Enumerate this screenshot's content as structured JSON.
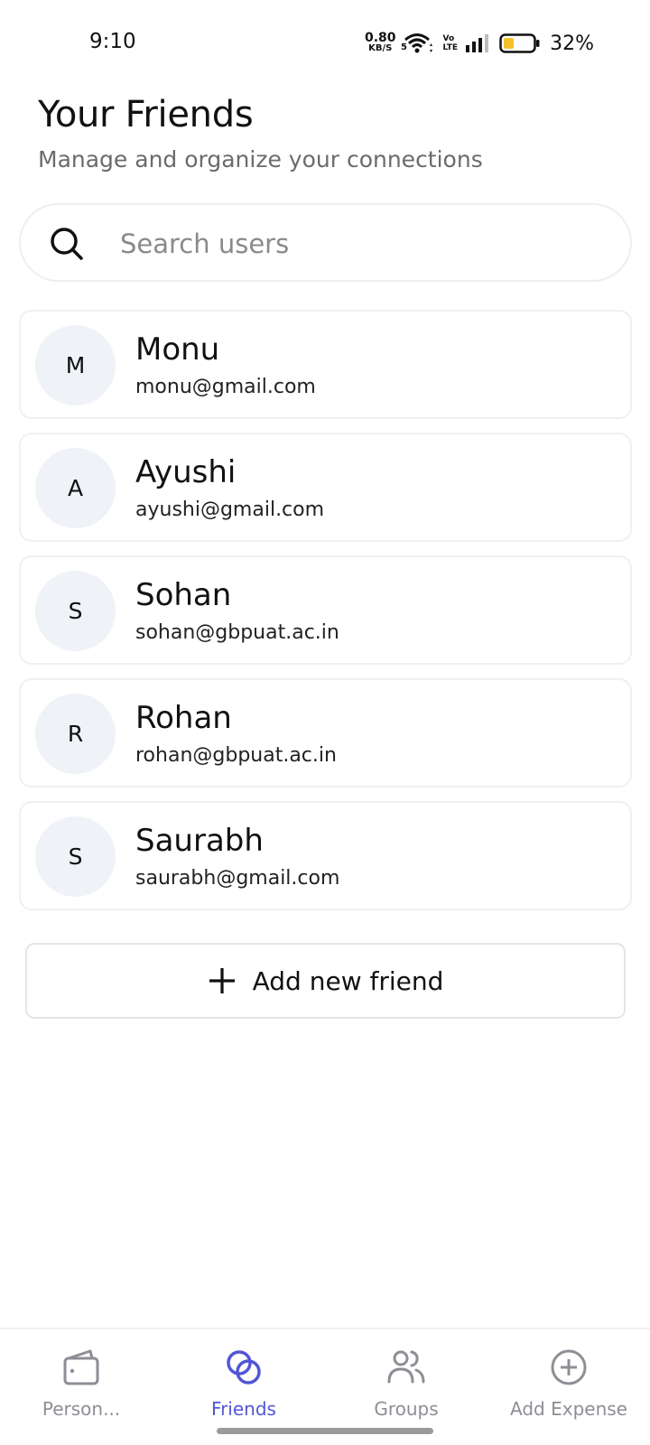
{
  "status_bar": {
    "time": "9:10",
    "net_speed_value": "0.80",
    "net_speed_unit": "KB/S",
    "wifi_badge": "5",
    "volte_top": "Vo",
    "volte_bottom": "LTE",
    "battery_percent": "32%"
  },
  "header": {
    "title": "Your Friends",
    "subtitle": "Manage and organize your connections"
  },
  "search": {
    "placeholder": "Search users",
    "value": ""
  },
  "friends": [
    {
      "initial": "M",
      "name": "Monu",
      "email": "monu@gmail.com"
    },
    {
      "initial": "A",
      "name": "Ayushi",
      "email": "ayushi@gmail.com"
    },
    {
      "initial": "S",
      "name": "Sohan",
      "email": "sohan@gbpuat.ac.in"
    },
    {
      "initial": "R",
      "name": "Rohan",
      "email": "rohan@gbpuat.ac.in"
    },
    {
      "initial": "S",
      "name": "Saurabh",
      "email": "saurabh@gmail.com"
    }
  ],
  "add_friend": {
    "label": "Add new friend",
    "icon": "plus-icon"
  },
  "bottom_nav": {
    "items": [
      {
        "label": "Person...",
        "icon": "wallet-icon",
        "active": false
      },
      {
        "label": "Friends",
        "icon": "friends-rings-icon",
        "active": true
      },
      {
        "label": "Groups",
        "icon": "users-icon",
        "active": false
      },
      {
        "label": "Add Expense",
        "icon": "plus-circle-icon",
        "active": false
      }
    ]
  },
  "colors": {
    "accent": "#5156d6",
    "inactive": "#8e8e96",
    "avatar_bg": "#eff2f7",
    "border": "#eef0f3",
    "battery_fill": "#f5c12a"
  }
}
